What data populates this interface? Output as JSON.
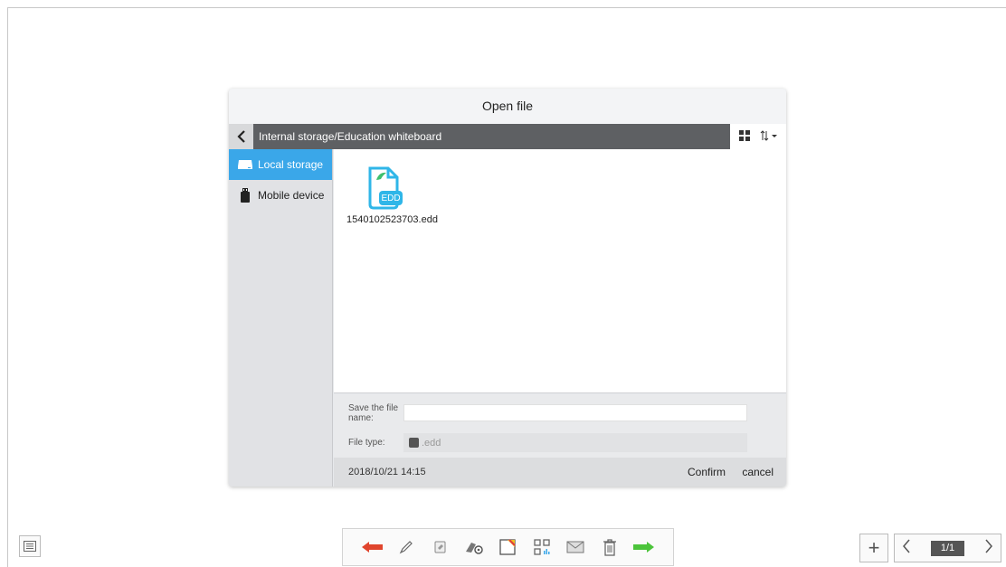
{
  "dialog": {
    "title": "Open file",
    "path": "Internal storage/Education whiteboard",
    "sidebar": [
      {
        "label": "Local storage",
        "icon": "hard-drive-icon",
        "active": true
      },
      {
        "label": "Mobile device",
        "icon": "usb-icon",
        "active": false
      }
    ],
    "files": [
      {
        "name": "1540102523703.edd",
        "badge": "EDD",
        "icon": "edd-file-icon"
      }
    ],
    "form": {
      "name_label": "Save the file name:",
      "name_value": "",
      "type_label": "File type:",
      "type_value": ".edd"
    },
    "footer": {
      "date": "2018/10/21 14:15",
      "confirm": "Confirm",
      "cancel": "cancel"
    }
  },
  "toolbar": {
    "tools": [
      "undo-arrow-icon",
      "pen-icon",
      "eraser-icon",
      "brush-settings-icon",
      "note-icon",
      "qr-code-icon",
      "mail-icon",
      "trash-icon",
      "redo-arrow-icon"
    ]
  },
  "pager": {
    "page": "1/1"
  },
  "colors": {
    "accent": "#3aa7e9",
    "pathbar": "#5e6063",
    "undo": "#e0452d",
    "redo": "#4cc43b"
  }
}
